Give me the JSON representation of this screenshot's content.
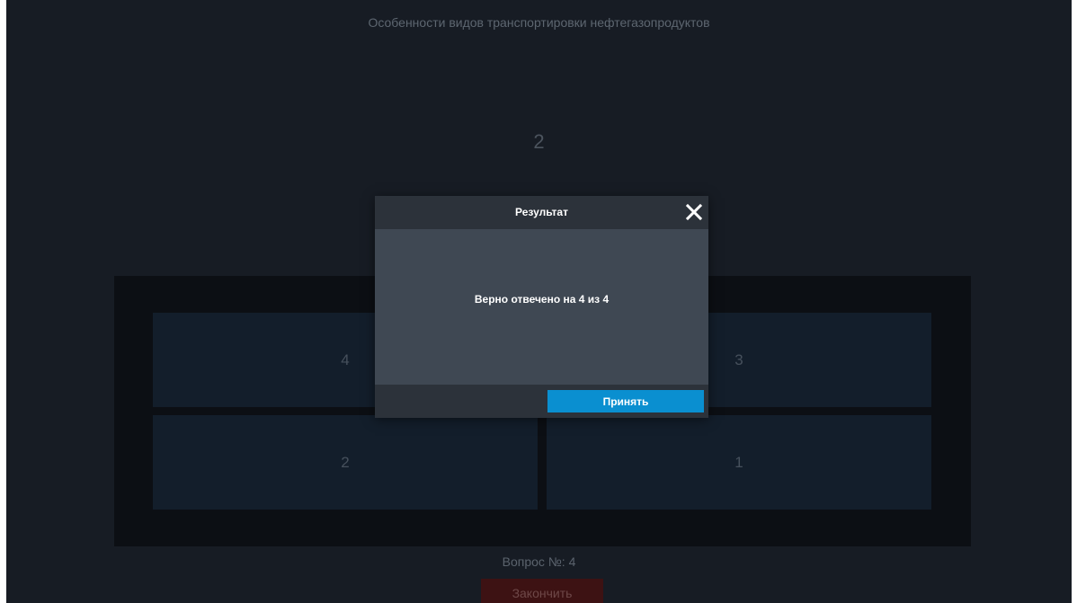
{
  "page": {
    "title": "Особенности видов транспортировки нефтегазопродуктов",
    "question_value": "2"
  },
  "answers": {
    "tiles": [
      "4",
      "3",
      "2",
      "1"
    ]
  },
  "footer": {
    "counter": "Вопрос №: 4",
    "finish_label": "Закончить"
  },
  "modal": {
    "title": "Результат",
    "close_icon": "close-icon",
    "message": "Верно отвечено на 4 из 4",
    "accept_label": "Принять"
  },
  "colors": {
    "background": "#171c24",
    "panel": "#0c0f14",
    "tile": "#131e2b",
    "modal_body": "#3f4853",
    "modal_bar": "#2c323a",
    "accent": "#0a8fd0",
    "finish": "#3d1213"
  }
}
